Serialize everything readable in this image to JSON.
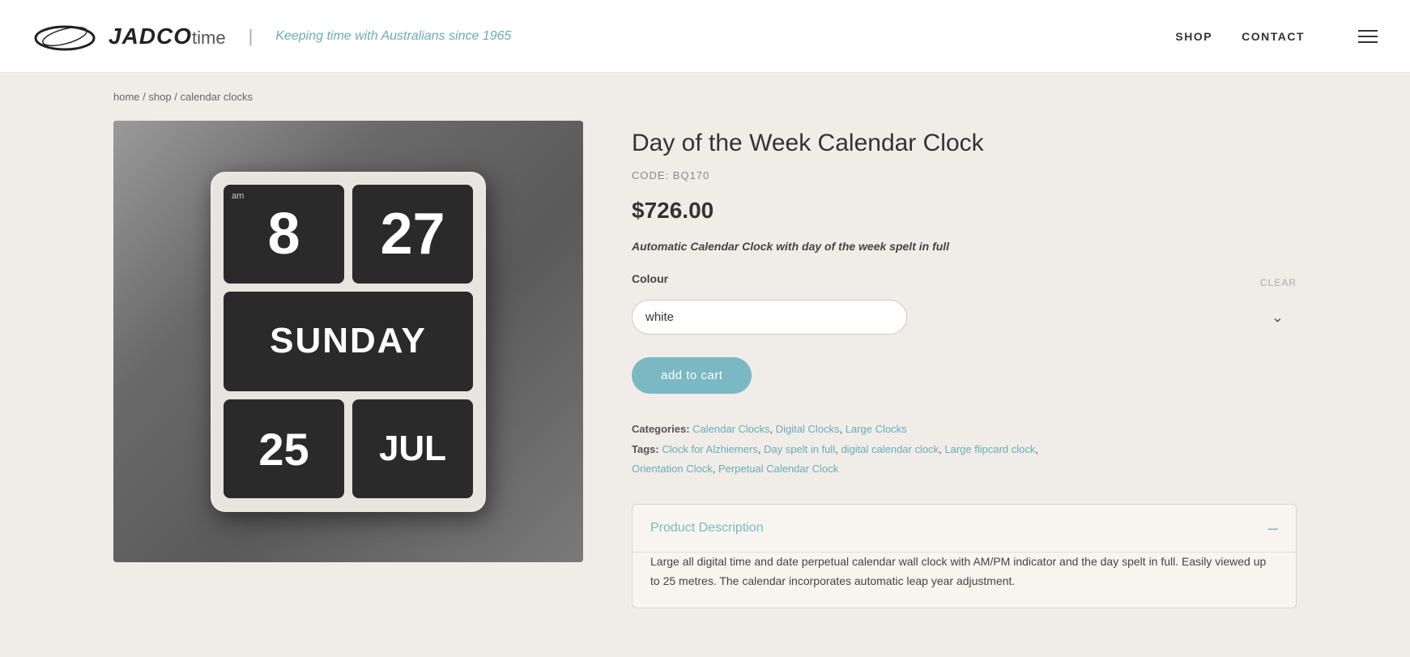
{
  "header": {
    "logo_jadco": "JADCO",
    "logo_time": "time",
    "tagline": "Keeping time with Australians since 1965",
    "nav": {
      "shop": "SHOP",
      "contact": "CONTACT"
    }
  },
  "breadcrumb": {
    "home": "home",
    "shop": "shop",
    "category": "calendar clocks"
  },
  "product": {
    "title": "Day of the Week Calendar Clock",
    "code_label": "CODE:",
    "code": "BQ170",
    "price": "$726.00",
    "tagline": "Automatic Calendar Clock with day of the week spelt in full",
    "colour_label": "Colour",
    "colour_clear": "CLEAR",
    "colour_selected": "white",
    "add_to_cart": "add to cart",
    "categories_label": "Categories:",
    "categories": [
      "Calendar Clocks",
      "Digital Clocks",
      "Large Clocks"
    ],
    "tags_label": "Tags:",
    "tags": [
      "Clock for Alzhiemers",
      "Day spelt in full",
      "digital calendar clock",
      "Large flipcard clock",
      "Orientation Clock",
      "Perpetual Calendar Clock"
    ],
    "clock_display": {
      "am": "am",
      "hour": "8",
      "minute": "27",
      "day": "SUNDAY",
      "date": "25",
      "month": "JUL"
    },
    "description": {
      "title": "Product Description",
      "body": "Large all digital time and date perpetual calendar wall clock with AM/PM indicator and the day spelt in full. Easily viewed up to 25 metres. The calendar incorporates automatic leap year adjustment."
    }
  }
}
